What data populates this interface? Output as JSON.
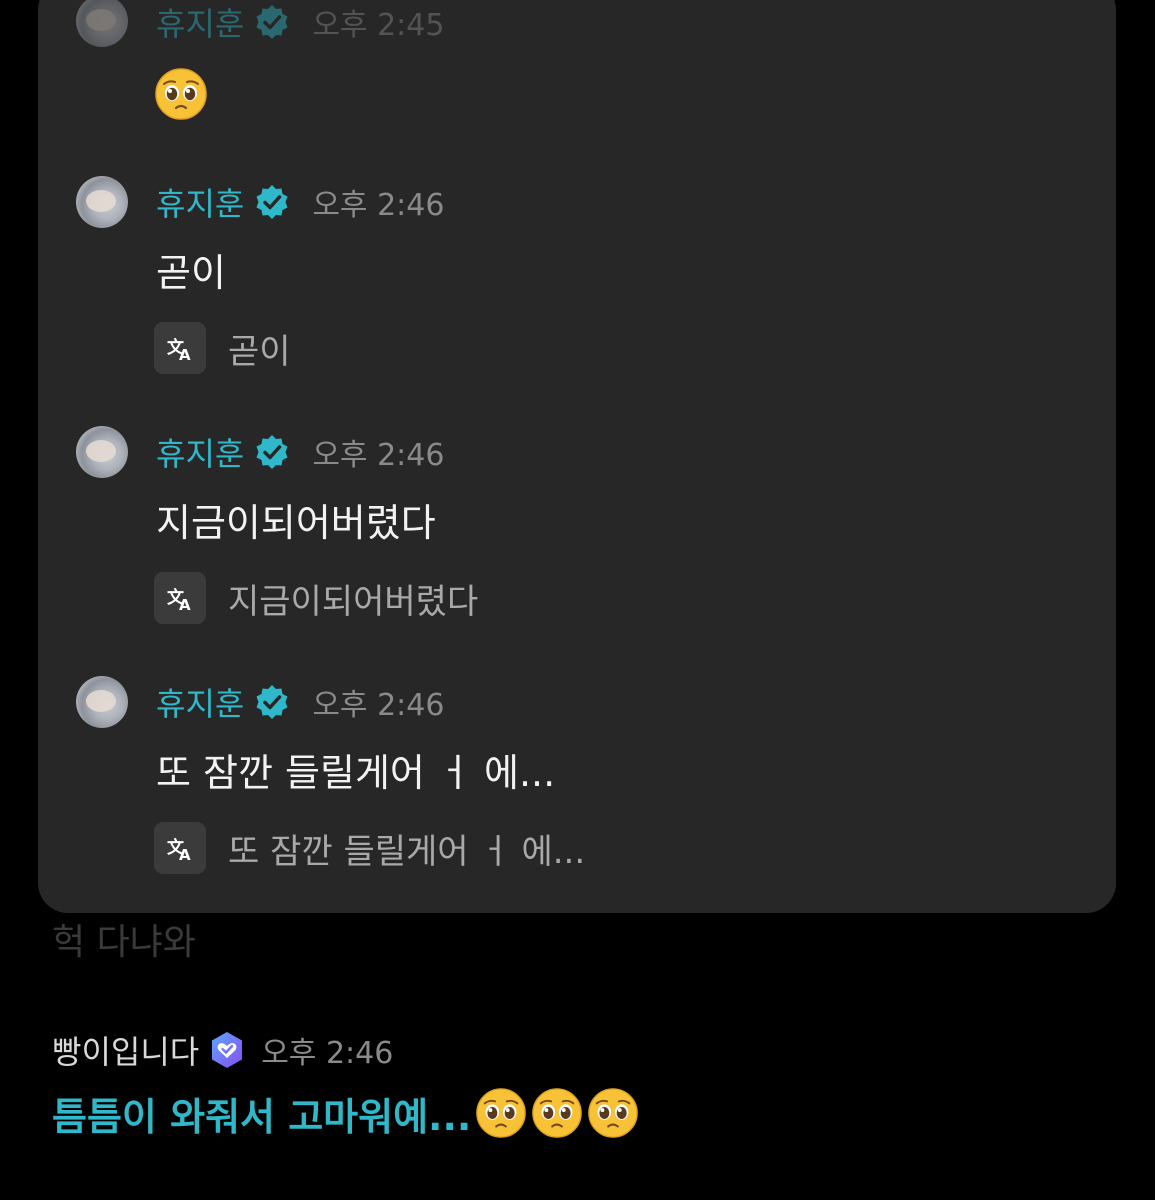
{
  "chat": {
    "messages": [
      {
        "author": "휴지훈",
        "time": "오후 2:45",
        "emoji": "pleading-face",
        "text": "",
        "translation": ""
      },
      {
        "author": "휴지훈",
        "time": "오후 2:46",
        "text": "곧이",
        "translation": "곧이"
      },
      {
        "author": "휴지훈",
        "time": "오후 2:46",
        "text": "지금이되어버렸다",
        "translation": "지금이되어버렸다"
      },
      {
        "author": "휴지훈",
        "time": "오후 2:46",
        "text": "또 잠깐 들릴게어 ㅓ 에...",
        "translation": "또 잠깐 들릴게어 ㅓ 에..."
      }
    ],
    "faded_text": "헉 다냐와",
    "fan_message": {
      "author": "빵이입니다",
      "time": "오후 2:46",
      "text": "틈틈이 와줘서 고마워예...",
      "emojis": [
        "pleading-face",
        "pleading-face",
        "pleading-face"
      ]
    }
  },
  "colors": {
    "background": "#000000",
    "panel": "#272727",
    "artist_name": "#2fb8c9",
    "verified_badge": "#2fb8c9",
    "fan_badge": "#7b5cf0",
    "highlight_message": "#2fb8c9"
  },
  "icons": {
    "verified": "verified-check-icon",
    "translate": "translate-icon",
    "fan_badge": "fan-heart-badge-icon"
  }
}
